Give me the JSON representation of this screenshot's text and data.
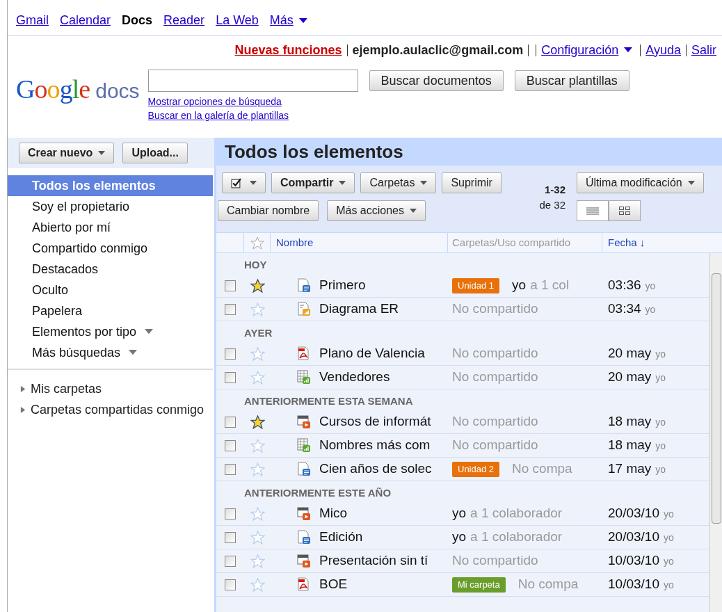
{
  "top_nav": [
    {
      "label": "Gmail",
      "selected": false,
      "dropdown": false
    },
    {
      "label": "Calendar",
      "selected": false,
      "dropdown": false
    },
    {
      "label": "Docs",
      "selected": true,
      "dropdown": false
    },
    {
      "label": "Reader",
      "selected": false,
      "dropdown": false
    },
    {
      "label": "La Web",
      "selected": false,
      "dropdown": false
    },
    {
      "label": "Más",
      "selected": false,
      "dropdown": true
    }
  ],
  "account_bar": {
    "new_features": "Nuevas funciones",
    "email": "ejemplo.aulaclic@gmail.com",
    "links": [
      {
        "label": "Configuración",
        "dropdown": true
      },
      {
        "label": "Ayuda",
        "dropdown": false
      },
      {
        "label": "Salir",
        "dropdown": false
      }
    ]
  },
  "logo": {
    "brand": "Google",
    "product": "docs"
  },
  "search": {
    "buttons": [
      "Buscar documentos",
      "Buscar plantillas"
    ],
    "links": [
      "Mostrar opciones de búsqueda",
      "Buscar en la galería de plantillas"
    ]
  },
  "sidebar": {
    "buttons": [
      {
        "label": "Crear nuevo",
        "dropdown": true
      },
      {
        "label": "Upload...",
        "dropdown": false
      }
    ],
    "items": [
      {
        "label": "Todos los elementos",
        "selected": true,
        "dropdown": false
      },
      {
        "label": "Soy el propietario",
        "selected": false,
        "dropdown": false
      },
      {
        "label": "Abierto por mí",
        "selected": false,
        "dropdown": false
      },
      {
        "label": "Compartido conmigo",
        "selected": false,
        "dropdown": false
      },
      {
        "label": "Destacados",
        "selected": false,
        "dropdown": false
      },
      {
        "label": "Oculto",
        "selected": false,
        "dropdown": false
      },
      {
        "label": "Papelera",
        "selected": false,
        "dropdown": false
      },
      {
        "label": "Elementos por tipo",
        "selected": false,
        "dropdown": true
      },
      {
        "label": "Más búsquedas",
        "selected": false,
        "dropdown": true
      }
    ],
    "folders": [
      {
        "label": "Mis carpetas",
        "expanded": false
      },
      {
        "label": "Carpetas compartidas conmigo",
        "expanded": false
      }
    ]
  },
  "main": {
    "title": "Todos los elementos",
    "toolbar": [
      {
        "label": "Compartir",
        "dropdown": true,
        "bold": true
      },
      {
        "label": "Carpetas",
        "dropdown": true,
        "bold": false
      },
      {
        "label": "Suprimir",
        "dropdown": false,
        "bold": false
      }
    ],
    "toolbar2": [
      {
        "label": "Cambiar nombre",
        "dropdown": false
      },
      {
        "label": "Más acciones",
        "dropdown": true
      }
    ],
    "pagination": {
      "range": "1-32",
      "total": "de 32"
    },
    "sort_button": "Última modificación",
    "view": [
      {
        "kind": "list",
        "selected": true
      },
      {
        "kind": "grid",
        "selected": false
      }
    ],
    "columns": [
      "Nombre",
      "Carpetas/Uso compartido",
      "Fecha ↓"
    ],
    "groups": [
      {
        "label": "HOY",
        "rows": [
          {
            "name": "Primero",
            "kind": "doc",
            "starred": true,
            "checked": false,
            "tag": {
              "label": "Unidad 1",
              "color": "#e8710a"
            },
            "owner": "yo",
            "sharing": "a 1 col",
            "date": "03:36",
            "by": "yo"
          },
          {
            "name": "Diagrama ER",
            "kind": "drawing",
            "starred": false,
            "checked": false,
            "sharing": "No compartido",
            "date": "03:34",
            "by": "yo"
          }
        ]
      },
      {
        "label": "AYER",
        "rows": [
          {
            "name": "Plano de Valencia",
            "kind": "pdf",
            "starred": false,
            "checked": false,
            "sharing": "No compartido",
            "date": "20 may",
            "by": "yo"
          },
          {
            "name": "Vendedores",
            "kind": "sheet",
            "starred": false,
            "checked": false,
            "sharing": "No compartido",
            "date": "20 may",
            "by": "yo"
          }
        ]
      },
      {
        "label": "ANTERIORMENTE ESTA SEMANA",
        "rows": [
          {
            "name": "Cursos de informát",
            "kind": "presentation",
            "starred": true,
            "checked": false,
            "sharing": "No compartido",
            "date": "18 may",
            "by": "yo"
          },
          {
            "name": "Nombres más com",
            "kind": "sheet",
            "starred": false,
            "checked": false,
            "sharing": "No compartido",
            "date": "18 may",
            "by": "yo"
          },
          {
            "name": "Cien años de solec",
            "kind": "doc",
            "starred": false,
            "checked": false,
            "tag": {
              "label": "Unidad 2",
              "color": "#e8710a"
            },
            "sharing": "No compa",
            "date": "17 may",
            "by": "yo"
          }
        ]
      },
      {
        "label": "ANTERIORMENTE ESTE AÑO",
        "rows": [
          {
            "name": "Mico",
            "kind": "presentation",
            "starred": false,
            "checked": false,
            "owner": "yo",
            "sharing": "a 1 colaborador",
            "date": "20/03/10",
            "by": "yo"
          },
          {
            "name": "Edición",
            "kind": "doc",
            "starred": false,
            "checked": false,
            "owner": "yo",
            "sharing": "a 1 colaborador",
            "date": "20/03/10",
            "by": "yo"
          },
          {
            "name": "Presentación sin tí",
            "kind": "presentation",
            "starred": false,
            "checked": false,
            "sharing": "No compartido",
            "date": "10/03/10",
            "by": "yo"
          },
          {
            "name": "BOE",
            "kind": "pdf",
            "starred": false,
            "checked": false,
            "tag": {
              "label": "Mi carpeta",
              "color": "#6a9e2b"
            },
            "sharing": "No compa",
            "date": "10/03/10",
            "by": "yo"
          }
        ]
      }
    ]
  }
}
